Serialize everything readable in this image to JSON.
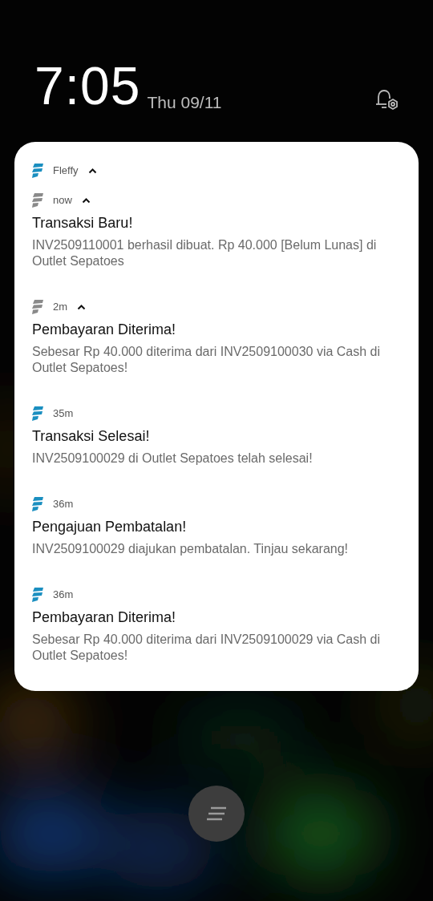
{
  "lock_screen": {
    "time": "7:05",
    "date": "Thu 09/11"
  },
  "notification_group": {
    "app_name": "Fleffy",
    "expanded": true,
    "notifications": [
      {
        "time": "now",
        "expanded": true,
        "title": "Transaksi Baru!",
        "body": "INV2509110001 berhasil dibuat. Rp 40.000 [Belum Lunas] di Outlet Sepatoes"
      },
      {
        "time": "2m",
        "expanded": true,
        "title": "Pembayaran Diterima!",
        "body": "Sebesar Rp 40.000 diterima dari INV2509100030 via Cash di Outlet Sepatoes!"
      },
      {
        "time": "35m",
        "expanded": false,
        "title": "Transaksi Selesai!",
        "body": "INV2509100029 di Outlet Sepatoes telah selesai!"
      },
      {
        "time": "36m",
        "expanded": false,
        "title": "Pengajuan Pembatalan!",
        "body": "INV2509100029 diajukan pembatalan. Tinjau sekarang!"
      },
      {
        "time": "36m",
        "expanded": false,
        "title": "Pembayaran Diterima!",
        "body": "Sebesar Rp 40.000 diterima dari INV2509100029 via Cash di Outlet Sepatoes!"
      }
    ]
  }
}
